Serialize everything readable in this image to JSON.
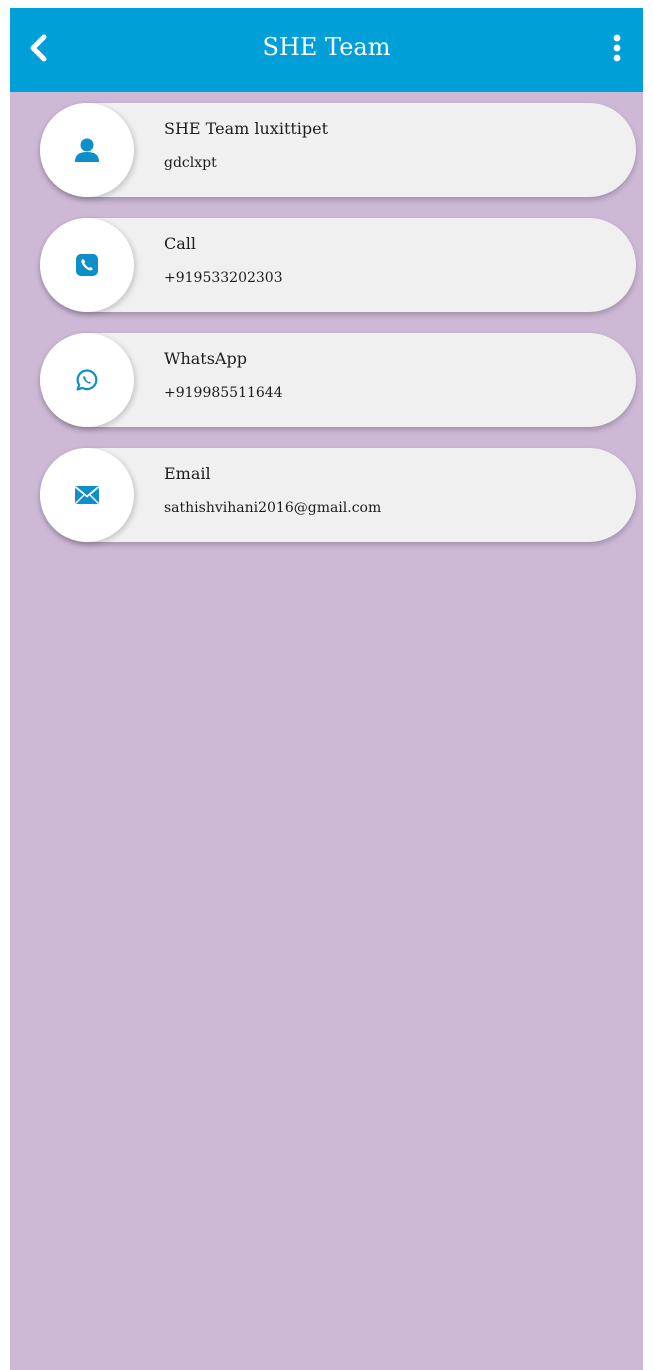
{
  "header": {
    "title": "SHE Team",
    "back_icon": "chevron-left-icon",
    "menu_icon": "more-vertical-icon",
    "color": "#019fd8"
  },
  "background_color": "#cdb9d6",
  "contacts": [
    {
      "icon": "person-icon",
      "label": "SHE Team luxittipet",
      "value": "gdclxpt"
    },
    {
      "icon": "phone-icon",
      "label": "Call",
      "value": "+919533202303"
    },
    {
      "icon": "whatsapp-icon",
      "label": "WhatsApp",
      "value": "+919985511644"
    },
    {
      "icon": "mail-icon",
      "label": "Email",
      "value": "sathishvihani2016@gmail.com"
    }
  ]
}
